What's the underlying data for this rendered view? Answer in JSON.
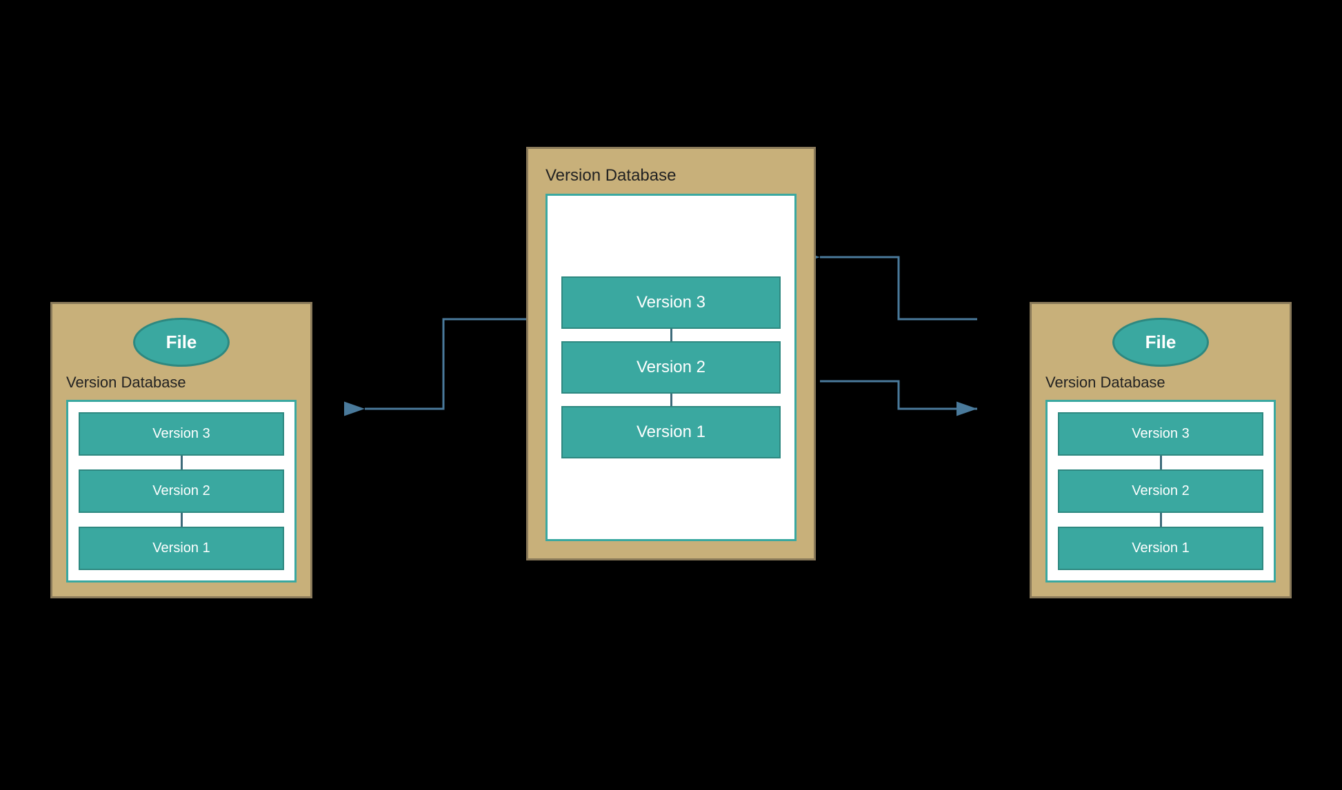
{
  "diagram": {
    "center_box": {
      "label": "Version Database",
      "versions": [
        "Version 3",
        "Version 2",
        "Version 1"
      ]
    },
    "left_box": {
      "file_label": "File",
      "label": "Version Database",
      "versions": [
        "Version 3",
        "Version 2",
        "Version 1"
      ]
    },
    "right_box": {
      "file_label": "File",
      "label": "Version Database",
      "versions": [
        "Version 3",
        "Version 2",
        "Version 1"
      ]
    }
  },
  "colors": {
    "background": "#000000",
    "box_bg": "#c8b07a",
    "box_border": "#8a7a5a",
    "teal": "#3aa8a0",
    "teal_dark": "#2d8880",
    "line_color": "#3d6b7a",
    "arrow_color": "#4a7a9b",
    "white": "#ffffff",
    "text_dark": "#222222",
    "text_white": "#ffffff"
  }
}
